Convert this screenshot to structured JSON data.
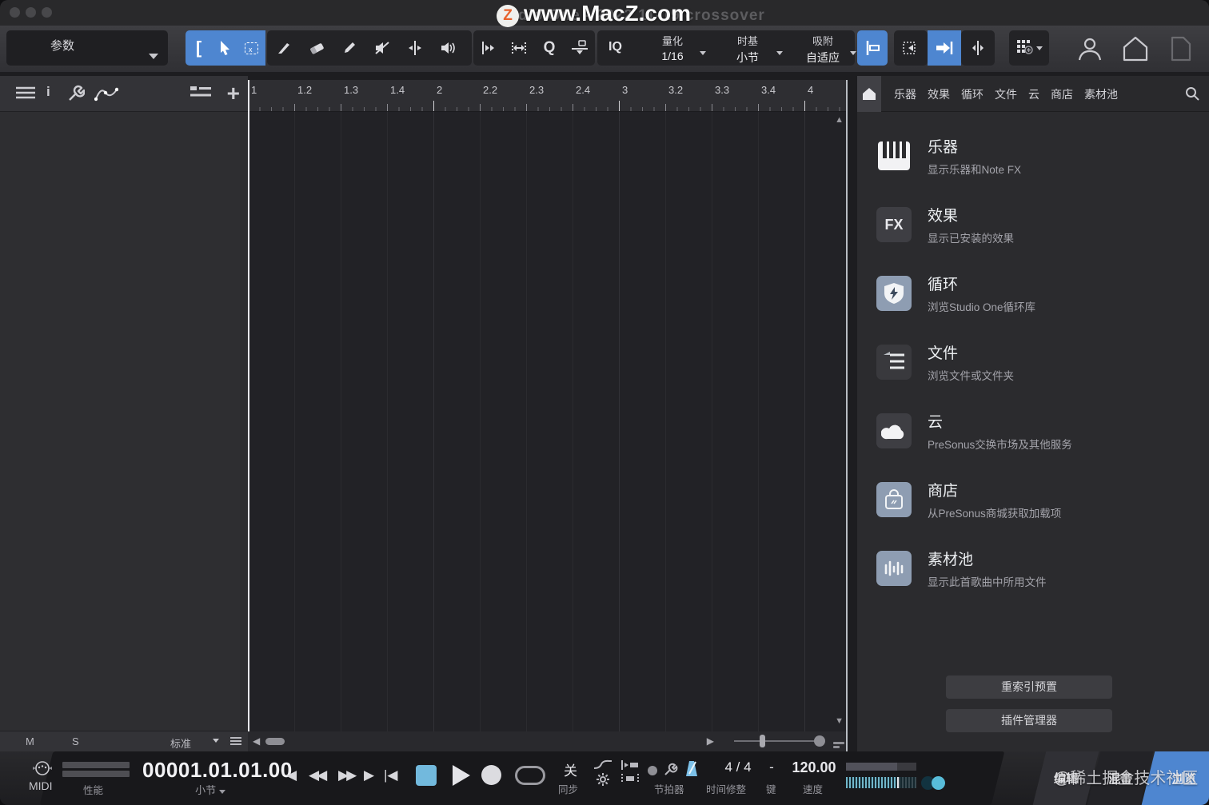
{
  "colors": {
    "accent_blue": "#4e86d0",
    "stop_blue": "#72b9dd",
    "tile_slate": "#8e9db2",
    "meter_teal": "#71b6ca"
  },
  "titlebar": {
    "logo_letter": "Z",
    "watermark": "www.MacZ.com",
    "ghost_title": "dio One - 2022 11-19 crossover"
  },
  "toolbar": {
    "params_label": "参数",
    "iq_label": "IQ",
    "q_tool_label": "Q",
    "quantize_label": "量化",
    "quantize_value": "1/16",
    "timebase_label": "时基",
    "timebase_value": "小节",
    "snap_label": "吸附",
    "snap_value": "自适应"
  },
  "ruler": {
    "ticks": [
      "1",
      "1.2",
      "1.3",
      "1.4",
      "2",
      "2.2",
      "2.3",
      "2.4",
      "3",
      "3.2",
      "3.3",
      "3.4",
      "4"
    ]
  },
  "track_footer": {
    "mute": "M",
    "solo": "S",
    "size_value": "标准"
  },
  "browser": {
    "tabs": [
      "乐器",
      "效果",
      "循环",
      "文件",
      "云",
      "商店",
      "素材池"
    ],
    "items": [
      {
        "icon": "piano-icon",
        "title": "乐器",
        "desc": "显示乐器和Note FX"
      },
      {
        "icon": "fx-icon",
        "icon_text": "FX",
        "title": "效果",
        "desc": "显示已安装的效果"
      },
      {
        "icon": "shield-bolt-icon",
        "title": "循环",
        "desc": "浏览Studio One循环库"
      },
      {
        "icon": "folder-list-icon",
        "title": "文件",
        "desc": "浏览文件或文件夹"
      },
      {
        "icon": "cloud-icon",
        "title": "云",
        "desc": "PreSonus交换市场及其他服务"
      },
      {
        "icon": "store-bag-icon",
        "title": "商店",
        "desc": "从PreSonus商城获取加载项"
      },
      {
        "icon": "waveform-icon",
        "title": "素材池",
        "desc": "显示此首歌曲中所用文件"
      }
    ],
    "footer_buttons": [
      "重索引预置",
      "插件管理器"
    ]
  },
  "transport": {
    "midi_label": "MIDI",
    "performance_label": "性能",
    "time_display": "00001.01.01.00",
    "time_unit": "小节",
    "sync_value": "关",
    "sync_label": "同步",
    "metronome_label": "节拍器",
    "timesig_value": "4 / 4",
    "timesig_label": "时间修整",
    "key_value": "-",
    "key_label": "键",
    "tempo_value": "120.00",
    "tempo_label": "速度",
    "edit_button": "编辑",
    "mix_button": "混音",
    "browse_button": "浏览",
    "watermark": "@稀土掘金技术社区"
  }
}
